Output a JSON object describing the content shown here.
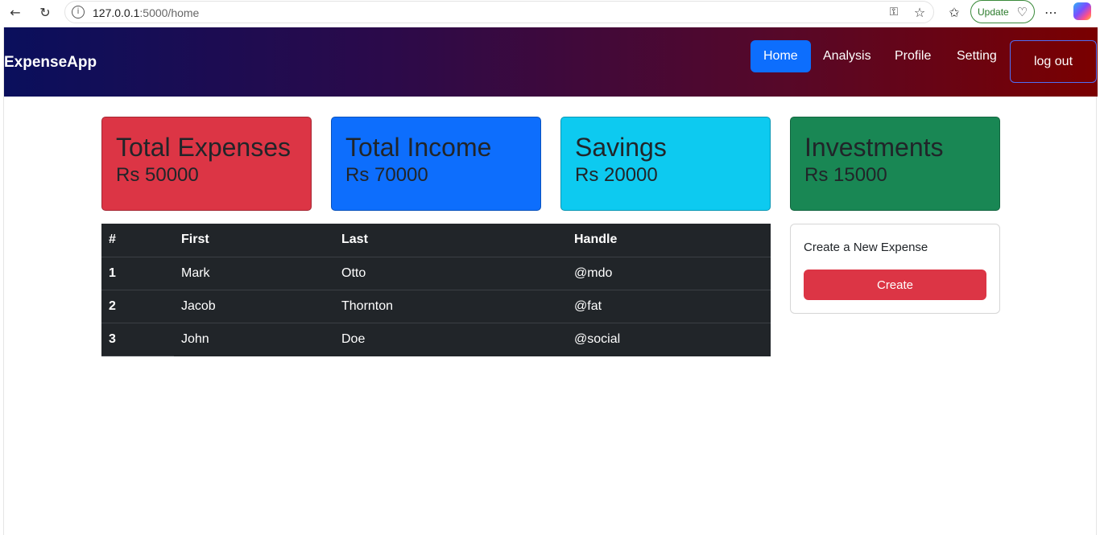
{
  "browser": {
    "url_host": "127.0.0.1",
    "url_rest": ":5000/home",
    "update_label": "Update"
  },
  "navbar": {
    "brand": "ExpenseApp",
    "items": [
      {
        "label": "Home",
        "active": true
      },
      {
        "label": "Analysis",
        "active": false
      },
      {
        "label": "Profile",
        "active": false
      },
      {
        "label": "Setting",
        "active": false
      }
    ],
    "logout_label": "log out"
  },
  "cards": [
    {
      "title": "Total Expenses",
      "value": "Rs 50000",
      "color": "#dc3545"
    },
    {
      "title": "Total Income",
      "value": "Rs 70000",
      "color": "#0d6efd"
    },
    {
      "title": "Savings",
      "value": "Rs 20000",
      "color": "#0dcaf0"
    },
    {
      "title": "Investments",
      "value": "Rs 15000",
      "color": "#198754"
    }
  ],
  "table": {
    "headers": [
      "#",
      "First",
      "Last",
      "Handle"
    ],
    "rows": [
      [
        "1",
        "Mark",
        "Otto",
        "@mdo"
      ],
      [
        "2",
        "Jacob",
        "Thornton",
        "@fat"
      ],
      [
        "3",
        "John",
        "Doe",
        "@social"
      ]
    ]
  },
  "create_panel": {
    "label": "Create a New Expense",
    "button_label": "Create"
  }
}
